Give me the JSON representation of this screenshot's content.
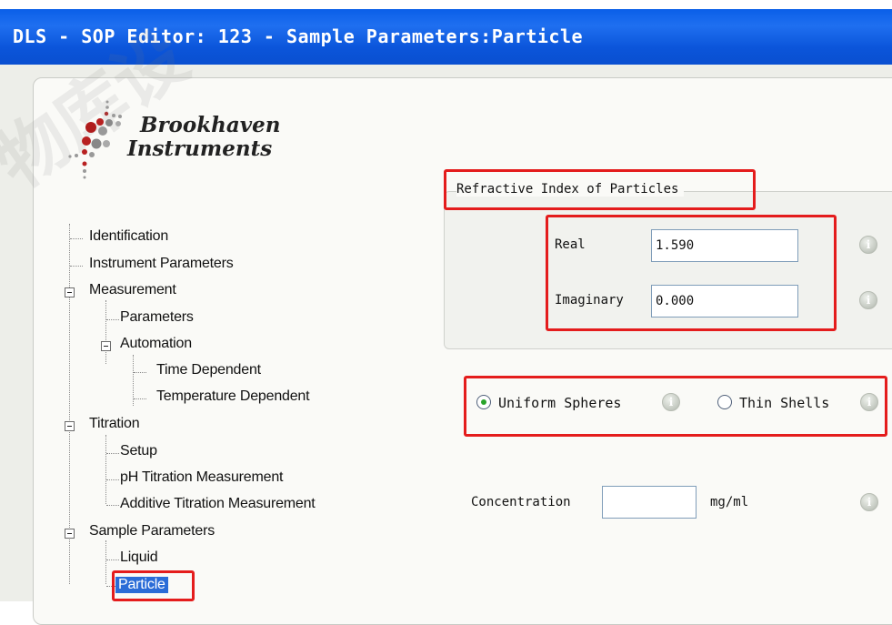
{
  "window": {
    "title": "DLS - SOP Editor: 123 - Sample Parameters:Particle"
  },
  "logo": {
    "line1": "Brookhaven",
    "line2": "Instruments"
  },
  "tree": {
    "items": [
      {
        "label": "Identification"
      },
      {
        "label": "Instrument Parameters"
      },
      {
        "label": "Measurement"
      },
      {
        "label": "Parameters"
      },
      {
        "label": "Automation"
      },
      {
        "label": "Time Dependent"
      },
      {
        "label": "Temperature Dependent"
      },
      {
        "label": "Titration"
      },
      {
        "label": "Setup"
      },
      {
        "label": "pH Titration Measurement"
      },
      {
        "label": "Additive Titration Measurement"
      },
      {
        "label": "Sample Parameters"
      },
      {
        "label": "Liquid"
      },
      {
        "label": "Particle"
      }
    ],
    "selected": "Particle"
  },
  "refractive_index": {
    "group_title": "Refractive Index of Particles",
    "real_label": "Real",
    "real_value": "1.590",
    "imaginary_label": "Imaginary",
    "imaginary_value": "0.000"
  },
  "shape": {
    "options": [
      {
        "label": "Uniform Spheres",
        "checked": true
      },
      {
        "label": "Thin Shells",
        "checked": false
      }
    ]
  },
  "concentration": {
    "label": "Concentration",
    "value": "",
    "unit": "mg/ml"
  },
  "icons": {
    "info": "info-icon",
    "toggle": "minus-toggle-icon",
    "logo_dots": "dot-cluster-logo-icon"
  },
  "colors": {
    "titlebar": "#0a55da",
    "highlight": "#e41c1c",
    "selection": "#2b6cd7"
  }
}
